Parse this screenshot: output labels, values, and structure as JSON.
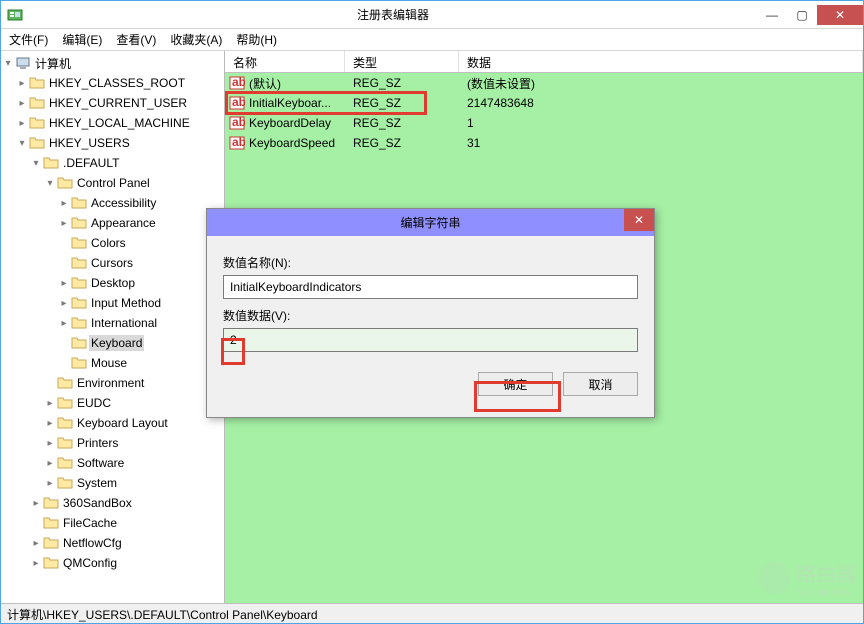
{
  "window": {
    "title": "注册表编辑器"
  },
  "menu": {
    "file": "文件(F)",
    "edit": "编辑(E)",
    "view": "查看(V)",
    "favorites": "收藏夹(A)",
    "help": "帮助(H)"
  },
  "tree": {
    "root": "计算机",
    "hkcr": "HKEY_CLASSES_ROOT",
    "hkcu": "HKEY_CURRENT_USER",
    "hklm": "HKEY_LOCAL_MACHINE",
    "hku": "HKEY_USERS",
    "default": ".DEFAULT",
    "control_panel": "Control Panel",
    "cp_items": {
      "accessibility": "Accessibility",
      "appearance": "Appearance",
      "colors": "Colors",
      "cursors": "Cursors",
      "desktop": "Desktop",
      "input_method": "Input Method",
      "international": "International",
      "keyboard": "Keyboard",
      "mouse": "Mouse"
    },
    "siblings": {
      "environment": "Environment",
      "eudc": "EUDC",
      "keyboard_layout": "Keyboard Layout",
      "printers": "Printers",
      "software": "Software",
      "system": "System"
    },
    "others": {
      "sandbox": "360SandBox",
      "filecache": "FileCache",
      "netflowcfg": "NetflowCfg",
      "qmconfig": "QMConfig"
    }
  },
  "list": {
    "col_name": "名称",
    "col_type": "类型",
    "col_data": "数据",
    "rows": [
      {
        "name": "(默认)",
        "type": "REG_SZ",
        "data": "(数值未设置)"
      },
      {
        "name": "InitialKeyboar...",
        "type": "REG_SZ",
        "data": "2147483648"
      },
      {
        "name": "KeyboardDelay",
        "type": "REG_SZ",
        "data": "1"
      },
      {
        "name": "KeyboardSpeed",
        "type": "REG_SZ",
        "data": "31"
      }
    ]
  },
  "dialog": {
    "title": "编辑字符串",
    "name_label": "数值名称(N):",
    "name_value": "InitialKeyboardIndicators",
    "data_label": "数值数据(V):",
    "data_value": "2",
    "ok": "确定",
    "cancel": "取消"
  },
  "status": {
    "path": "计算机\\HKEY_USERS\\.DEFAULT\\Control Panel\\Keyboard"
  },
  "watermark": {
    "text": "路由器",
    "sub": "luyouqi.com"
  }
}
